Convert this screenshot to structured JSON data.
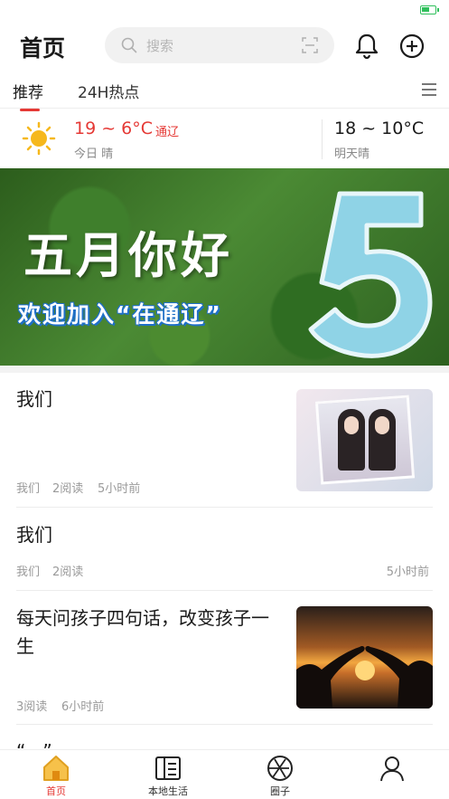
{
  "header": {
    "title": "首页",
    "search_placeholder": "搜索"
  },
  "tabs": [
    {
      "label": "推荐",
      "active": true
    },
    {
      "label": "24H热点",
      "active": false
    }
  ],
  "weather": {
    "today_temp": "19 ~ 6°C",
    "city": "通辽",
    "today_desc": "今日 晴",
    "tomorrow_temp": "18 ~ 10°C",
    "tomorrow_desc": "明天晴"
  },
  "banner": {
    "title": "五月你好",
    "subtitle": "欢迎加入“在通辽”"
  },
  "feed": [
    {
      "title": "我们",
      "source": "我们",
      "reads": "2阅读",
      "time": "5小时前"
    },
    {
      "title": "我们",
      "source": "我们",
      "reads": "2阅读",
      "time": "5小时前"
    },
    {
      "title": "每天问孩子四句话，改变孩子一生",
      "reads": "3阅读",
      "time": "6小时前"
    }
  ],
  "peek_title": "“...”",
  "tabbar": [
    {
      "label": "首页",
      "icon": "home-icon",
      "active": true
    },
    {
      "label": "本地生活",
      "icon": "local-life-icon",
      "active": false
    },
    {
      "label": "圈子",
      "icon": "circle-icon",
      "active": false
    },
    {
      "label": "",
      "icon": "profile-icon",
      "active": false
    }
  ],
  "colors": {
    "accent": "#e53935",
    "home_icon": "#f0a020"
  }
}
